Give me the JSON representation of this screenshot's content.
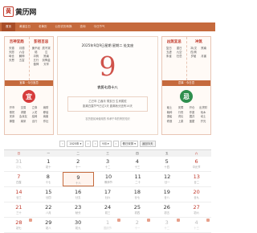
{
  "header": {
    "logo_char": "黄",
    "logo_text": "黄历网"
  },
  "nav": [
    "首页",
    "黄道吉日",
    "老黄历",
    "公历农历转换",
    "查询",
    "今日节气"
  ],
  "left_panel": {
    "col1_title": "吉神宜趋",
    "col1_words": [
      "天德",
      "月德",
      "天愿",
      "六合",
      "母仓",
      "解神",
      "天恩",
      "五富"
    ],
    "col2_title": "彭祖百忌",
    "col2_words": [
      "庚不经络",
      "辰不哭泣",
      "冲狗",
      "煞南",
      "五行",
      "剑锋金",
      "值神",
      "天牢"
    ],
    "bar": "宜事 · 今日宜忌",
    "yi_label": "宜",
    "yi_words": [
      "开市",
      "交易",
      "立券",
      "纳财",
      "祭祀",
      "求嗣",
      "入宅",
      "移徙",
      "安床",
      "会亲友",
      "结网",
      "纳畜",
      "嫁娶",
      "纳采",
      "出行",
      "作灶"
    ]
  },
  "right_panel": {
    "col1_title": "凶煞宜忌",
    "col1_words": [
      "复日",
      "重日",
      "五虚",
      "九空",
      "朱雀",
      "归忌"
    ],
    "col2_title": "冲煞",
    "col2_words": [
      "冲(戊戌)狗",
      "煞南",
      "岁破",
      "月害"
    ],
    "bar": "忌事 · 今日忌",
    "ji_label": "忌",
    "ji_words": [
      "破土",
      "安葬",
      "开仓",
      "出货财",
      "栽种",
      "行丧",
      "作梁",
      "伐木",
      "造船",
      "词讼",
      "掘井",
      "动土",
      "修造",
      "上梁",
      "盖屋",
      "开光"
    ]
  },
  "center": {
    "top_line": "2025年9月9日星期 星期二 处女座",
    "day": "9",
    "lunar_line": "农历七月十八",
    "ganzhi_1": "乙巳年 乙酉月 癸亥日 生肖属蛇",
    "ganzhi_2": "距离白露节气已过1天 距离秋分还有14天",
    "note": "农历是民间使用的 传承千年的黄历知识"
  },
  "controls": {
    "prev": "‹",
    "year": "2025年",
    "month": "9月",
    "next": "›",
    "holiday": "假日安排",
    "today_btn": "返回今天"
  },
  "calendar": {
    "weekdays": [
      "日",
      "一",
      "二",
      "三",
      "四",
      "五",
      "六"
    ],
    "weeks": [
      [
        {
          "d": "31",
          "l": "初九",
          "cls": "other we"
        },
        {
          "d": "1",
          "l": "初十",
          "cls": ""
        },
        {
          "d": "2",
          "l": "十一",
          "cls": ""
        },
        {
          "d": "3",
          "l": "十二",
          "cls": ""
        },
        {
          "d": "4",
          "l": "十三",
          "cls": ""
        },
        {
          "d": "5",
          "l": "十四",
          "cls": ""
        },
        {
          "d": "6",
          "l": "中元节",
          "cls": "we"
        }
      ],
      [
        {
          "d": "7",
          "l": "白露",
          "cls": "we"
        },
        {
          "d": "8",
          "l": "十七",
          "cls": ""
        },
        {
          "d": "9",
          "l": "十八",
          "cls": "today"
        },
        {
          "d": "10",
          "l": "教师节",
          "cls": ""
        },
        {
          "d": "11",
          "l": "二十",
          "cls": ""
        },
        {
          "d": "12",
          "l": "廿一",
          "cls": ""
        },
        {
          "d": "13",
          "l": "廿二",
          "cls": "we"
        }
      ],
      [
        {
          "d": "14",
          "l": "廿三",
          "cls": "we"
        },
        {
          "d": "15",
          "l": "廿四",
          "cls": ""
        },
        {
          "d": "16",
          "l": "廿五",
          "cls": ""
        },
        {
          "d": "17",
          "l": "廿六",
          "cls": ""
        },
        {
          "d": "18",
          "l": "廿七",
          "cls": ""
        },
        {
          "d": "19",
          "l": "廿八",
          "cls": ""
        },
        {
          "d": "20",
          "l": "廿九",
          "cls": "we"
        }
      ],
      [
        {
          "d": "21",
          "l": "三十",
          "cls": "we"
        },
        {
          "d": "22",
          "l": "八月",
          "cls": ""
        },
        {
          "d": "23",
          "l": "秋分",
          "cls": ""
        },
        {
          "d": "24",
          "l": "初三",
          "cls": ""
        },
        {
          "d": "25",
          "l": "初四",
          "cls": ""
        },
        {
          "d": "26",
          "l": "初五",
          "cls": ""
        },
        {
          "d": "27",
          "l": "初六",
          "cls": "we"
        }
      ],
      [
        {
          "d": "28",
          "l": "初七",
          "cls": "we rest"
        },
        {
          "d": "29",
          "l": "初八",
          "cls": ""
        },
        {
          "d": "30",
          "l": "初九",
          "cls": ""
        },
        {
          "d": "1",
          "l": "国庆节",
          "cls": "other rest"
        },
        {
          "d": "2",
          "l": "十一",
          "cls": "other rest"
        },
        {
          "d": "3",
          "l": "十二",
          "cls": "other rest"
        },
        {
          "d": "4",
          "l": "十三",
          "cls": "other we rest"
        }
      ]
    ]
  }
}
